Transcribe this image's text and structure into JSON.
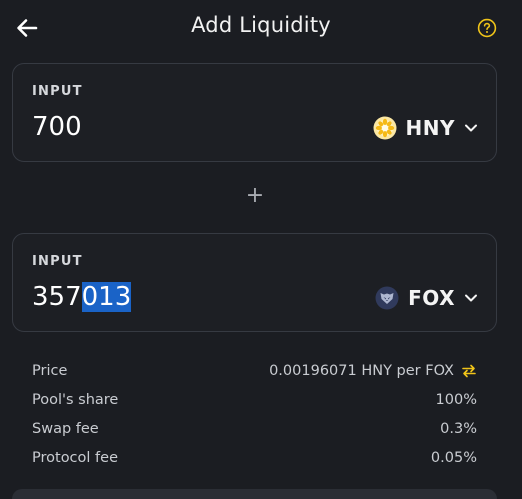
{
  "header": {
    "title": "Add Liquidity",
    "back_icon": "arrow-left-icon",
    "help_icon": "question-circle-icon",
    "accent_color": "#f0c419"
  },
  "input_a": {
    "label": "INPUT",
    "value": "700",
    "token": "HNY",
    "token_icon": "honey-token-icon"
  },
  "plus_symbol": "+",
  "input_b": {
    "label": "INPUT",
    "value_unselected": "357",
    "value_selected": "013",
    "token": "FOX",
    "token_icon": "fox-token-icon",
    "selection_color": "#1a63c7"
  },
  "details": {
    "price_label": "Price",
    "price_value": "0.00196071 HNY per FOX",
    "share_label": "Pool's share",
    "share_value": "100%",
    "swap_fee_label": "Swap fee",
    "swap_fee_value": "0.3%",
    "protocol_fee_label": "Protocol fee",
    "protocol_fee_value": "0.05%"
  }
}
